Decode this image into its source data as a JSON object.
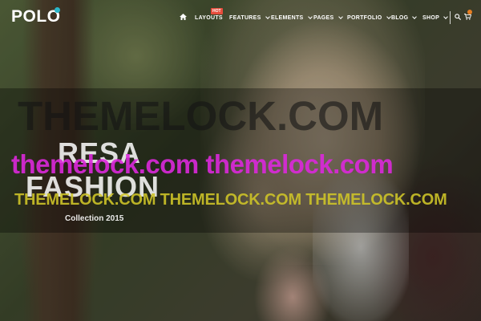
{
  "header": {
    "logo": "POLO",
    "nav": {
      "items": [
        {
          "label": "LAYOUTS",
          "badge": "HOT"
        },
        {
          "label": "FEATURES"
        },
        {
          "label": "ELEMENTS"
        },
        {
          "label": "PAGES"
        },
        {
          "label": "PORTFOLIO"
        },
        {
          "label": "BLOG"
        },
        {
          "label": "SHOP"
        }
      ]
    },
    "icons": {
      "home": "home-icon",
      "search": "search-icon",
      "cart": "cart-icon"
    }
  },
  "hero": {
    "title_line1": "RESA",
    "title_line2": "FASHION",
    "subtitle": "Collection 2015"
  },
  "watermark": {
    "big": "THEMELOCK.COM",
    "pink": "themelock.com themelock.com",
    "yellow": "THEMELOCK.COM THEMELOCK.COM THEMELOCK.COM"
  },
  "colors": {
    "accent": "#29b6c9",
    "badge": "#e74c3c",
    "cart_badge": "#e67e22",
    "watermark_pink": "#dc28dc",
    "watermark_yellow": "#cdc328"
  }
}
